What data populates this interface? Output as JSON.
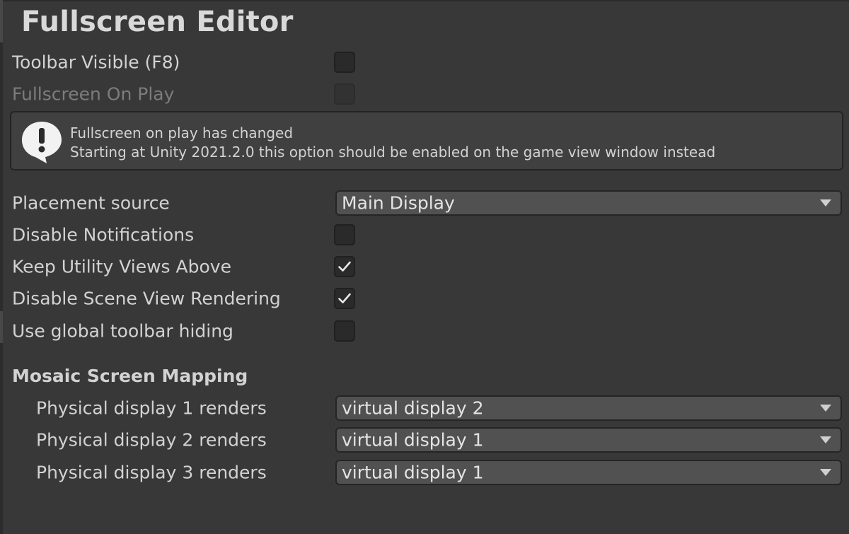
{
  "title": "Fullscreen Editor",
  "settings": {
    "toolbar_visible": {
      "label": "Toolbar Visible (F8)",
      "checked": false
    },
    "fullscreen_on_play": {
      "label": "Fullscreen On Play",
      "checked": false,
      "disabled": true
    },
    "help": {
      "icon": "warning-icon",
      "line1": "Fullscreen on play has changed",
      "line2": "Starting at Unity 2021.2.0 this option should be enabled on the game view window instead"
    },
    "placement_source": {
      "label": "Placement source",
      "value": "Main Display"
    },
    "disable_notifications": {
      "label": "Disable Notifications",
      "checked": false
    },
    "keep_utility_views_above": {
      "label": "Keep Utility Views Above",
      "checked": true
    },
    "disable_scene_view_rendering": {
      "label": "Disable Scene View Rendering",
      "checked": true
    },
    "use_global_toolbar_hiding": {
      "label": "Use global toolbar hiding",
      "checked": false
    }
  },
  "mosaic": {
    "header": "Mosaic Screen Mapping",
    "rows": [
      {
        "label": "Physical display 1 renders",
        "value": "virtual display 2"
      },
      {
        "label": "Physical display 2 renders",
        "value": "virtual display 1"
      },
      {
        "label": "Physical display 3 renders",
        "value": "virtual display 1"
      }
    ]
  },
  "colors": {
    "background": "#383838",
    "field": "#2a2a2a",
    "dropdown": "#515151",
    "text": "#d2d2d2",
    "disabled_text": "#7c7c7c"
  }
}
